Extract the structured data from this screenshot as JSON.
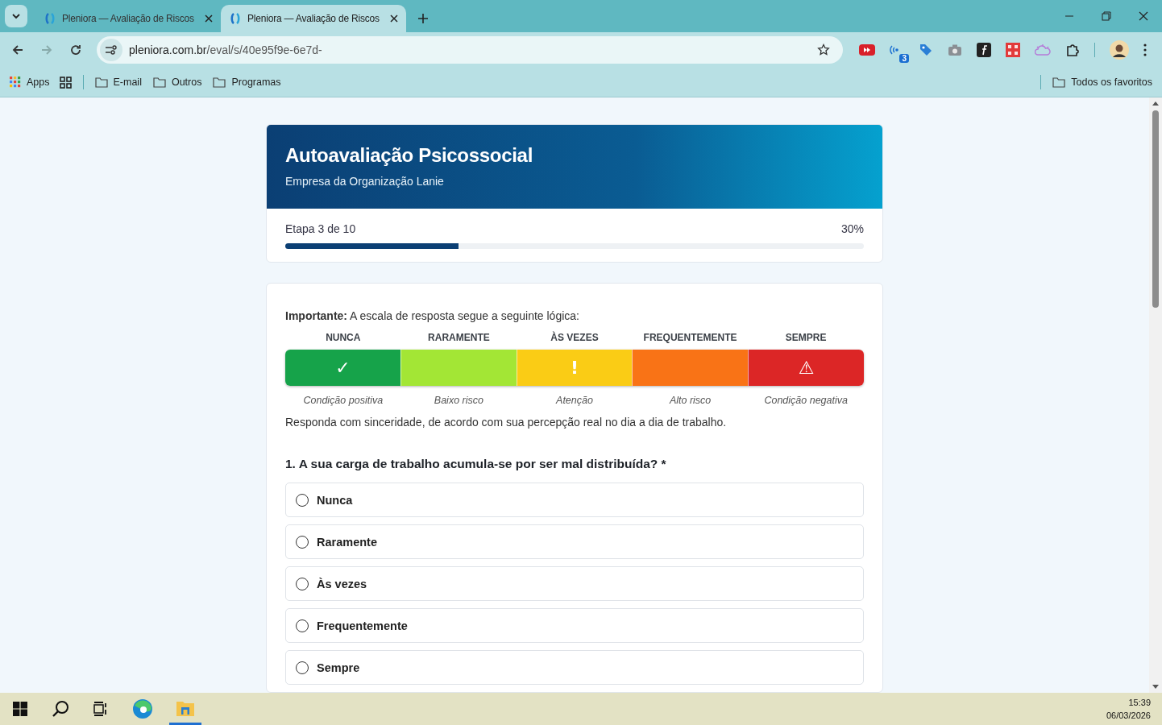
{
  "browser": {
    "tabs": [
      {
        "title": "Pleniora — Avaliação de Riscos",
        "selected": false
      },
      {
        "title": "Pleniora — Avaliação de Riscos",
        "selected": true
      }
    ],
    "url_host": "pleniora.com.br",
    "url_path": "/eval/s/40e95f9e-6e7d-",
    "extension_badge": "3",
    "bookmarks": [
      {
        "label": "Apps",
        "kind": "apps"
      },
      {
        "label": "E-mail",
        "kind": "folder"
      },
      {
        "label": "Outros",
        "kind": "folder"
      },
      {
        "label": "Programas",
        "kind": "folder"
      }
    ],
    "all_bookmarks": "Todos os favoritos"
  },
  "header": {
    "title": "Autoavaliação Psicossocial",
    "subtitle": "Empresa da Organização Lanie"
  },
  "progress": {
    "label": "Etapa 3 de 10",
    "percent": "30%",
    "level": 0.3
  },
  "intro": "**Importante:** A escala de resposta segue a seguinte lógica:",
  "scale": [
    {
      "label": "NUNCA",
      "symbol": "✓",
      "caption": "Condição positiva",
      "color": "#16a34a"
    },
    {
      "label": "RARAMENTE",
      "caption": "Baixo risco",
      "color": "#a3e635"
    },
    {
      "label": "ÀS VEZES",
      "symbol": "!",
      "caption": "Atenção",
      "color": "#facc15"
    },
    {
      "label": "FREQUENTEMENTE",
      "caption": "Alto risco",
      "color": "#f97316"
    },
    {
      "label": "SEMPRE",
      "symbol": "⚠",
      "caption": "Condição negativa",
      "color": "#dc2626"
    }
  ],
  "instruction": "Responda com sinceridade, de acordo com sua percepção real no dia a dia de trabalho.",
  "question": {
    "text": "1. A sua carga de trabalho acumula-se por ser mal distribuída? *",
    "options": [
      {
        "label": "Nunca",
        "selected": false
      },
      {
        "label": "Raramente",
        "selected": false
      },
      {
        "label": "Às vezes",
        "selected": false
      },
      {
        "label": "Frequentemente",
        "selected": false
      },
      {
        "label": "Sempre",
        "selected": false
      }
    ]
  },
  "taskbar": {
    "time": "15:39",
    "date": "06/03/2026"
  }
}
